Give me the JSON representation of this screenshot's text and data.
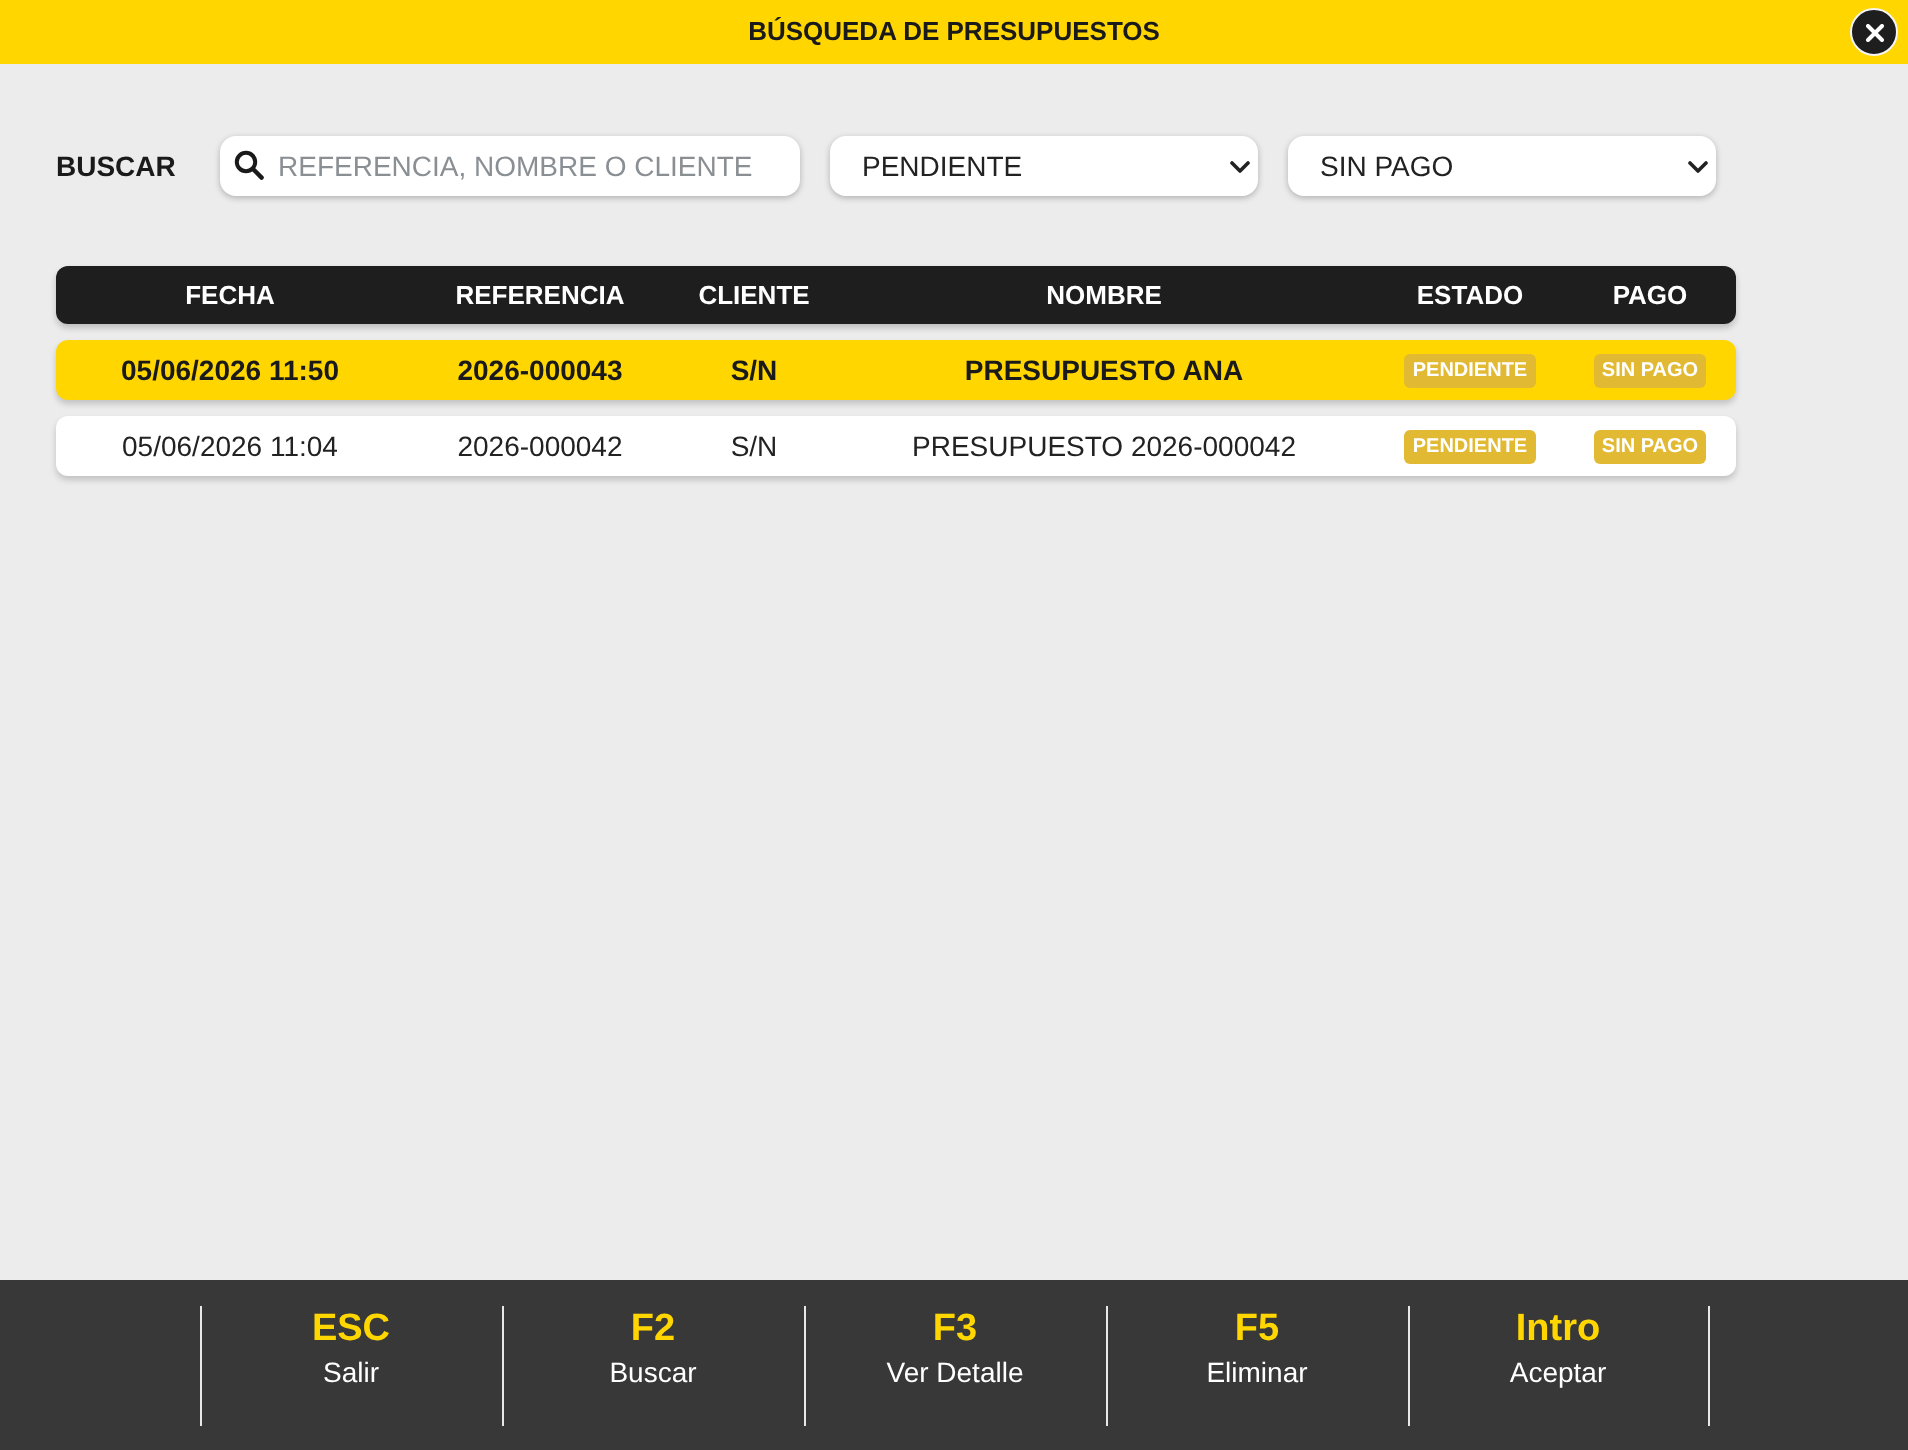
{
  "window": {
    "title": "BÚSQUEDA DE PRESUPUESTOS"
  },
  "filters": {
    "label": "BUSCAR",
    "search": {
      "placeholder": "REFERENCIA, NOMBRE O CLIENTE"
    },
    "estado": {
      "value": "PENDIENTE"
    },
    "pago": {
      "value": "SIN PAGO"
    }
  },
  "table": {
    "columns": [
      "FECHA",
      "REFERENCIA",
      "CLIENTE",
      "NOMBRE",
      "ESTADO",
      "PAGO"
    ],
    "rows": [
      {
        "selected": true,
        "fecha": "05/06/2026 11:50",
        "referencia": "2026-000043",
        "cliente": "S/N",
        "nombre": "PRESUPUESTO ANA",
        "estado": "PENDIENTE",
        "pago": "SIN PAGO"
      },
      {
        "selected": false,
        "fecha": "05/06/2026 11:04",
        "referencia": "2026-000042",
        "cliente": "S/N",
        "nombre": "PRESUPUESTO 2026-000042",
        "estado": "PENDIENTE",
        "pago": "SIN PAGO"
      }
    ]
  },
  "shortcuts": [
    {
      "key": "ESC",
      "label": "Salir"
    },
    {
      "key": "F2",
      "label": "Buscar"
    },
    {
      "key": "F3",
      "label": "Ver Detalle"
    },
    {
      "key": "F5",
      "label": "Eliminar"
    },
    {
      "key": "Intro",
      "label": "Aceptar"
    }
  ]
}
